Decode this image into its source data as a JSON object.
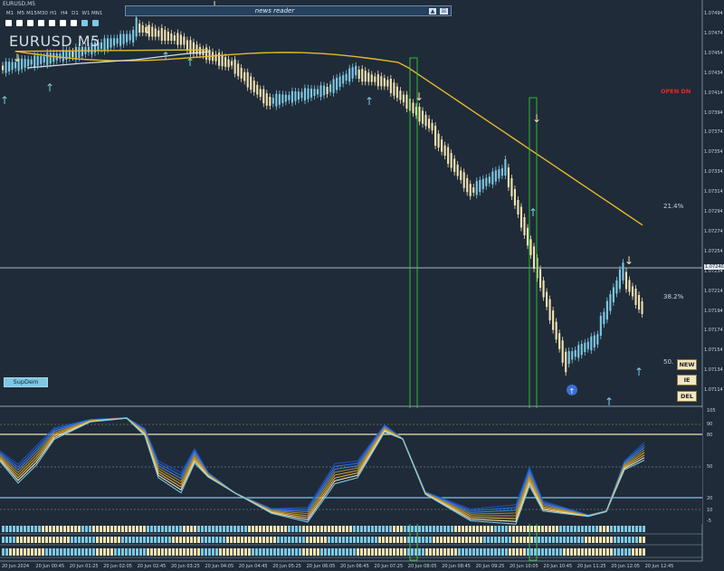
{
  "symbol_tiny": "EURUSD,M5",
  "symbol_big": "EURUSD   M5",
  "timeframes": [
    "M1",
    "M5",
    "M15",
    "M30",
    "H1",
    "H4",
    "D1",
    "W1",
    "MN1"
  ],
  "timeframe_active": [
    false,
    false,
    false,
    false,
    false,
    false,
    false,
    true,
    true
  ],
  "news_reader": {
    "title": "news reader",
    "minimize_icon": "▲",
    "close_icon": "☒"
  },
  "open_dn": "OPEN DN",
  "fib": {
    "l214": "21.4%",
    "l382": "38.2%",
    "l50": "50."
  },
  "buttons": {
    "new": "NEW",
    "ie": "IE",
    "del": "DEL"
  },
  "supdem": "SupDem",
  "price_labels": [
    "1.07494",
    "1.07474",
    "1.07454",
    "1.07434",
    "1.07414",
    "1.07394",
    "1.07374",
    "1.07354",
    "1.07334",
    "1.07314",
    "1.07294",
    "1.07274",
    "1.07254",
    "1.07234",
    "1.07214",
    "1.07194",
    "1.07174",
    "1.07154",
    "1.07134",
    "1.07114"
  ],
  "current_price": "1.07240",
  "time_labels": [
    "20 Jun 2024",
    "20 Jun 00:45",
    "20 Jun 01:25",
    "20 Jun 02:05",
    "20 Jun 02:45",
    "20 Jun 03:25",
    "20 Jun 04:05",
    "20 Jun 04:45",
    "20 Jun 05:25",
    "20 Jun 06:05",
    "20 Jun 06:45",
    "20 Jun 07:25",
    "20 Jun 08:05",
    "20 Jun 08:45",
    "20 Jun 09:25",
    "20 Jun 10:05",
    "20 Jun 10:45",
    "20 Jun 11:25",
    "20 Jun 12:05",
    "20 Jun 12:45"
  ],
  "osc_labels": [
    "105",
    "90",
    "80",
    "50",
    "20",
    "10",
    "-5"
  ],
  "colors": {
    "background": "#1f2b38",
    "bull": "#7ec8e3",
    "bear": "#f3e2b0",
    "ma": "#e3b92a",
    "open_dn": "#e02a2a"
  }
}
